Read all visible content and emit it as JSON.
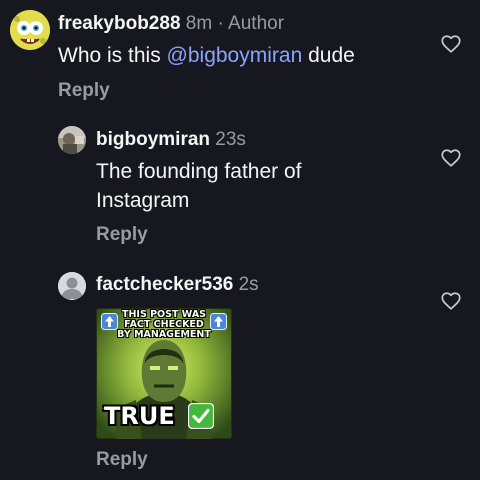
{
  "comments": [
    {
      "username": "freakybob288",
      "time": "8m",
      "separator": "·",
      "role": "Author",
      "text_before": "Who is this ",
      "mention": "@bigboymiran",
      "text_after": " dude",
      "reply_label": "Reply",
      "avatar_icon": "spongebob-avatar"
    },
    {
      "username": "bigboymiran",
      "time": "23s",
      "text_line1": "The founding father of",
      "text_line2": "Instagram",
      "reply_label": "Reply",
      "avatar_icon": "photo-avatar"
    },
    {
      "username": "factchecker536",
      "time": "2s",
      "reply_label": "Reply",
      "avatar_icon": "default-user-avatar",
      "meme": {
        "line1": "THIS POST WAS",
        "line2": "FACT CHECKED",
        "line3": "BY MANAGEMENT",
        "verdict": "TRUE",
        "check_icon": "green-check-icon",
        "arrow_icon": "up-arrow-icon"
      }
    }
  ],
  "colors": {
    "background": "#17171f",
    "text": "#f5f5f5",
    "muted": "#9a9aa2",
    "mention": "#8aa3ff"
  }
}
